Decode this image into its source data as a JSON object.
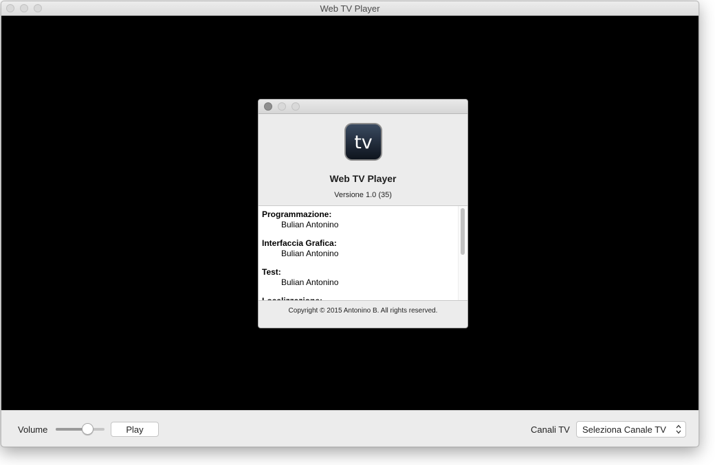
{
  "window": {
    "title": "Web TV Player"
  },
  "bottom_bar": {
    "volume_label": "Volume",
    "volume_level": 0.65,
    "play_label": "Play",
    "channels_label": "Canali TV",
    "channel_selected": "Seleziona Canale TV"
  },
  "about": {
    "icon_text": "tv",
    "app_name": "Web TV Player",
    "version": "Versione 1.0 (35)",
    "credits": [
      {
        "role": "Programmazione:",
        "person": "Bulian Antonino"
      },
      {
        "role": "Interfaccia Grafica:",
        "person": "Bulian Antonino"
      },
      {
        "role": "Test:",
        "person": "Bulian Antonino"
      },
      {
        "role": "Localizzazione:",
        "person": ""
      }
    ],
    "copyright": "Copyright © 2015 Antonino B. All rights reserved."
  },
  "colors": {
    "video_background": "#000000",
    "chrome": "#ececec",
    "icon_background": "#1f2a3a"
  },
  "icons": [
    "close-icon",
    "minimize-icon",
    "zoom-icon",
    "tv-app-icon",
    "select-arrows-icon"
  ]
}
